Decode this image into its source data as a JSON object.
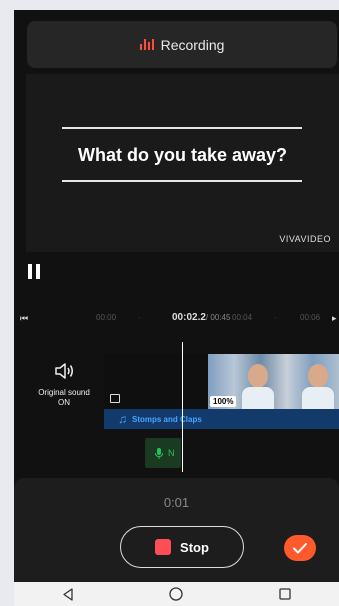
{
  "recording_banner": {
    "label": "Recording",
    "accent": "#ff4d3c"
  },
  "preview": {
    "caption": "What do you take away?",
    "watermark": "VIVAVIDEO"
  },
  "timeline": {
    "ticks": [
      "00:00",
      "00:04",
      "00:06"
    ],
    "current_time": "00:02.2",
    "total_time": "/ 00:45"
  },
  "original_sound": {
    "line1": "Original sound",
    "line2": "ON"
  },
  "clip": {
    "percent": "100%"
  },
  "audio_track": {
    "label": "Stomps and Claps",
    "color": "#4aa3ff"
  },
  "record_track": {
    "label": "N"
  },
  "bottom": {
    "timer": "0:01",
    "stop_label": "Stop",
    "confirm_color": "#ff5a2c"
  },
  "icons": [
    "bars-icon",
    "pause-icon",
    "skip-start-icon",
    "speaker-icon",
    "image-icon",
    "music-note-icon",
    "mic-icon",
    "check-icon",
    "back-icon",
    "home-icon",
    "recents-icon"
  ]
}
